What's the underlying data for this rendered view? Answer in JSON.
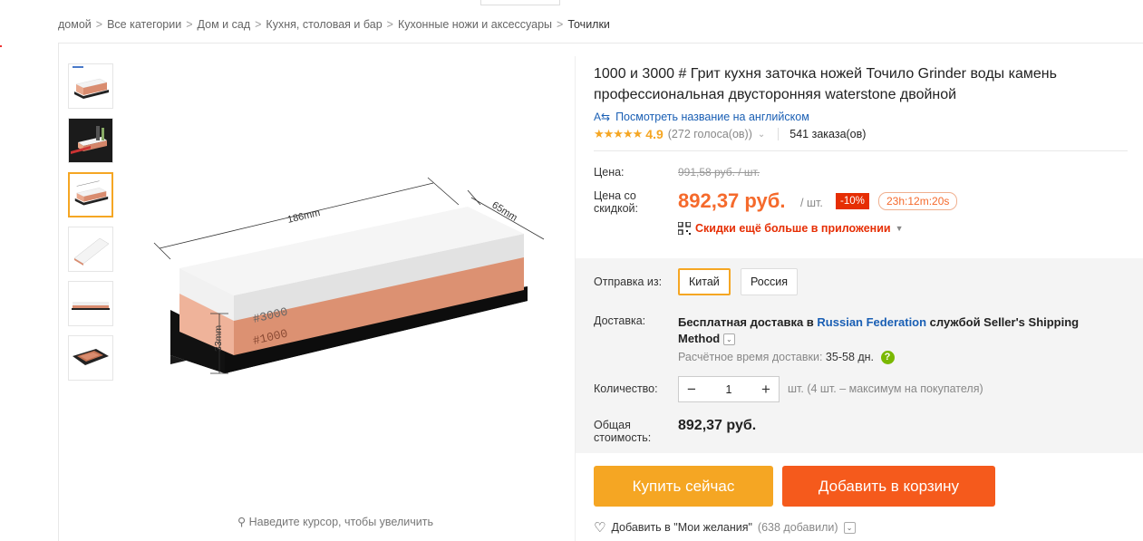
{
  "breadcrumb": {
    "items": [
      "домой",
      "Все категории",
      "Дом и сад",
      "Кухня, столовая и бар",
      "Кухонные ножи и аксессуары"
    ],
    "current": "Точилки",
    "separator": ">"
  },
  "gallery": {
    "zoom_hint": "Наведите курсор, чтобы увеличить",
    "image_labels": {
      "length": "186mm",
      "width": "65mm",
      "height": "33mm",
      "grit_top": "#3000",
      "grit_bottom": "#1000"
    }
  },
  "product": {
    "title": "1000 и 3000 # Грит кухня заточка ножей Точило Grinder воды камень профессиональная двусторонняя waterstone двойной",
    "translate_link": "Посмотреть название на английском",
    "rating_stars": "★★★★★",
    "rating_score": "4.9",
    "votes": "(272 голоса(ов))",
    "orders": "541 заказа(ов)"
  },
  "price": {
    "label_price": "Цена:",
    "old_price": "991,58 руб. / шт.",
    "label_discount_line1": "Цена со",
    "label_discount_line2": "скидкой:",
    "new_price": "892,37 руб.",
    "unit": "/ шт.",
    "discount_badge": "-10%",
    "timer": "23h:12m:20s",
    "app_deal": "Скидки ещё больше в приложении"
  },
  "shipping": {
    "label_from": "Отправка из:",
    "options": [
      "Китай",
      "Россия"
    ],
    "selected": "Китай",
    "label_delivery": "Доставка:",
    "delivery_pre": "Бесплатная доставка в ",
    "delivery_country": "Russian Federation",
    "delivery_post": " службой Seller's Shipping Method",
    "eta_label": "Расчётное время доставки:",
    "eta_days": "35-58 дн."
  },
  "quantity": {
    "label": "Количество:",
    "value": "1",
    "note": "шт. (4 шт. – максимум на покупателя)"
  },
  "total": {
    "label_line1": "Общая",
    "label_line2": "стоимость:",
    "value": "892,37 руб."
  },
  "actions": {
    "buy_now": "Купить сейчас",
    "add_to_cart": "Добавить в корзину",
    "wishlist": "Добавить в \"Мои желания\"",
    "wishlist_count": "(638 добавили)"
  },
  "colors": {
    "accent_orange": "#f5a623",
    "price_orange": "#f56a2c",
    "cart_orange": "#f55a1c",
    "discount_red": "#e62e04",
    "link_blue": "#1a5fb4"
  }
}
